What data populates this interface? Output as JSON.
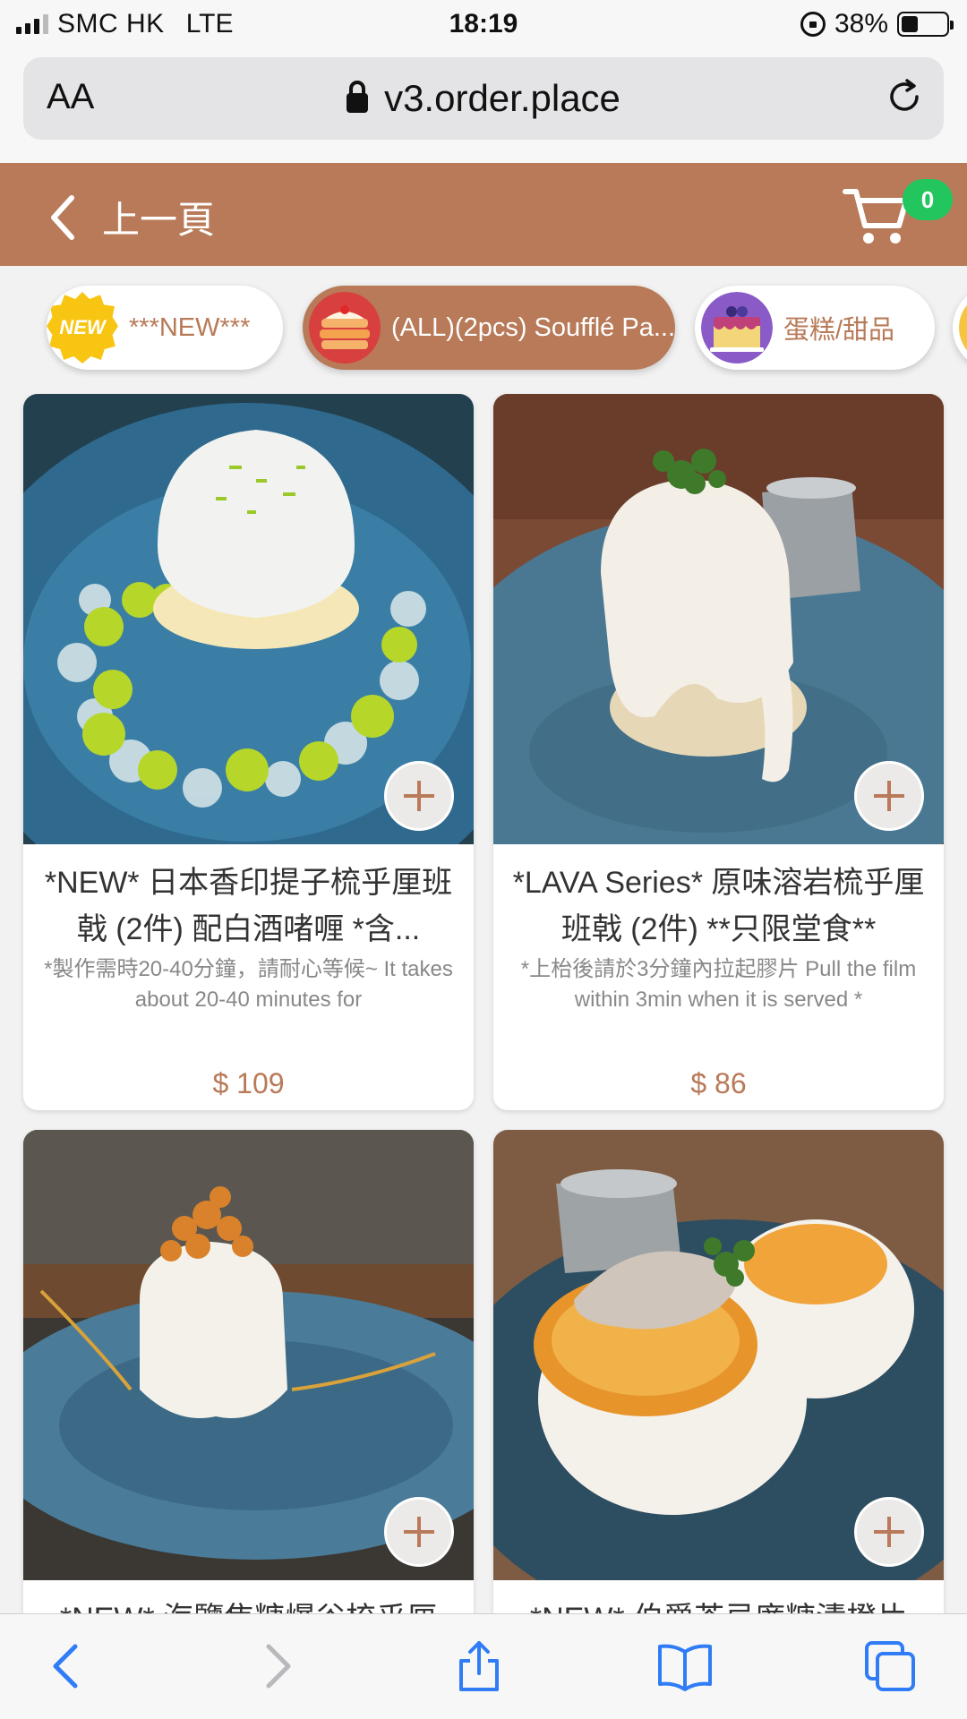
{
  "status_bar": {
    "carrier": "SMC HK",
    "network": "LTE",
    "time": "18:19",
    "battery": "38%",
    "battery_level": 0.38
  },
  "browser": {
    "aa_label": "AA",
    "url": "v3.order.place"
  },
  "header": {
    "back_label": "上一頁",
    "cart_count": "0",
    "accent_color": "#b87a58",
    "badge_color": "#22c55e"
  },
  "categories": [
    {
      "label": "***NEW***",
      "badge": "NEW",
      "active": false
    },
    {
      "label": "(ALL)(2pcs) Soufflé Pa...",
      "active": true
    },
    {
      "label": "蛋糕/甜品",
      "active": false
    }
  ],
  "products": [
    {
      "title": "*NEW* 日本香印提子梳乎厘班戟 (2件) 配白酒啫喱 *含...",
      "desc": "*製作需時20-40分鐘，請耐心等候~ It takes about 20-40 minutes for",
      "price": "$ 109"
    },
    {
      "title": "*LAVA Series* 原味溶岩梳乎厘班戟 (2件) **只限堂食**",
      "desc": "*上枱後請於3分鐘內拉起膠片 Pull the film within 3min when it is served *",
      "price": "$ 86"
    },
    {
      "title": "*NEW* 海鹽焦糖爆谷梳乎厘",
      "desc": "",
      "price": ""
    },
    {
      "title": "*NEW* 伯爵茶忌廉糖漬橙片",
      "desc": "",
      "price": ""
    }
  ]
}
